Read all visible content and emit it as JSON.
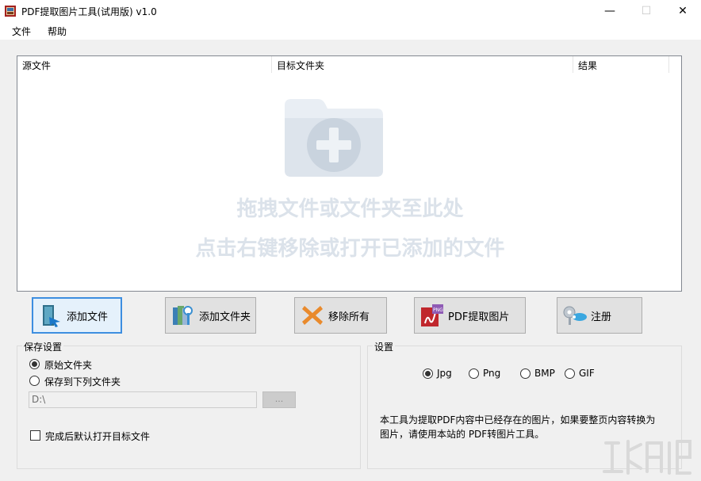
{
  "window": {
    "title": "PDF提取图片工具(试用版) v1.0",
    "minimize": "—",
    "maximize": "☐",
    "close": "✕"
  },
  "menu": {
    "file": "文件",
    "help": "帮助"
  },
  "list": {
    "columns": [
      "源文件",
      "目标文件夹",
      "结果"
    ],
    "hint_line1": "拖拽文件或文件夹至此处",
    "hint_line2": "点击右键移除或打开已添加的文件"
  },
  "toolbar": {
    "add_file": "添加文件",
    "add_folder": "添加文件夹",
    "remove_all": "移除所有",
    "extract": "PDF提取图片",
    "register": "注册"
  },
  "save_settings": {
    "title": "保存设置",
    "option_original": "原始文件夹",
    "option_custom": "保存到下列文件夹",
    "selected": "原始文件夹",
    "path_value": "D:\\",
    "browse_label": "...",
    "open_after_label": "完成后默认打开目标文件",
    "open_after_checked": false
  },
  "settings": {
    "title": "设置",
    "formats": [
      "Jpg",
      "Png",
      "BMP",
      "GIF"
    ],
    "selected_format": "Jpg",
    "description": "本工具为提取PDF内容中已经存在的图片，如果要整页内容转换为图片，请使用本站的 PDF转图片工具。"
  },
  "colors": {
    "focus_border": "#3d8ee0",
    "hint_text": "#dbe2ea",
    "button_face": "#e1e1e1"
  }
}
